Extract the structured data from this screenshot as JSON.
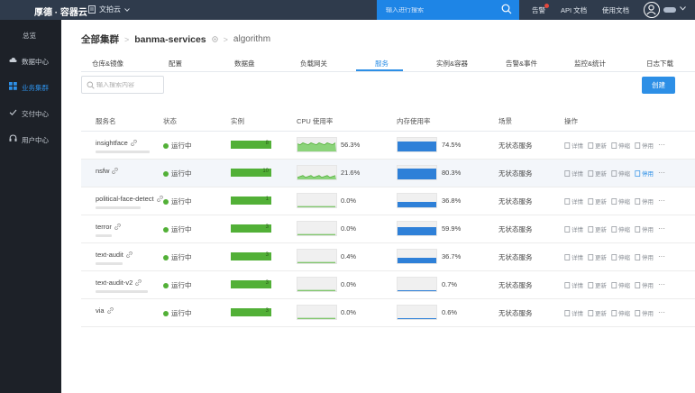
{
  "topbar": {
    "brand": "厚德 · 容器云",
    "project": "文拍云",
    "search_placeholder": "输入进行搜索",
    "nav": [
      "告警",
      "API 文档",
      "使用文档"
    ]
  },
  "sidebar": {
    "items": [
      {
        "label": "总览"
      },
      {
        "label": "数据中心"
      },
      {
        "label": "业务集群"
      },
      {
        "label": "交付中心"
      },
      {
        "label": "用户中心"
      }
    ],
    "active_index": 2
  },
  "breadcrumb": [
    "全部集群",
    "banma-services",
    "algorithm"
  ],
  "tabs": [
    "仓库&镜像",
    "配置",
    "数据盘",
    "负载网关",
    "服务",
    "实例&容器",
    "告警&事件",
    "监控&统计",
    "日志下载"
  ],
  "active_tab": 4,
  "filter_placeholder": "输入搜索内容",
  "create_label": "创建",
  "table": {
    "headers": [
      "服务名",
      "状态",
      "实例",
      "CPU 使用率",
      "内存使用率",
      "场景",
      "操作"
    ],
    "ops": [
      "详情",
      "更新",
      "伸缩",
      "停用"
    ],
    "more": "···",
    "rows": [
      {
        "name": "insightface",
        "status": "运行中",
        "instances": "8",
        "cpu": "56.3%",
        "cpu_value": 56.3,
        "mem": "74.5%",
        "mem_value": 74.5,
        "scene": "无状态服务"
      },
      {
        "name": "nsfw",
        "status": "运行中",
        "instances": "10",
        "cpu": "21.6%",
        "cpu_value": 21.6,
        "mem": "80.3%",
        "mem_value": 80.3,
        "scene": "无状态服务"
      },
      {
        "name": "political-face-detect",
        "status": "运行中",
        "instances": "1",
        "cpu": "0.0%",
        "cpu_value": 0.0,
        "mem": "36.8%",
        "mem_value": 36.8,
        "scene": "无状态服务"
      },
      {
        "name": "terror",
        "status": "运行中",
        "instances": "3",
        "cpu": "0.0%",
        "cpu_value": 0.0,
        "mem": "59.9%",
        "mem_value": 59.9,
        "scene": "无状态服务"
      },
      {
        "name": "text-audit",
        "status": "运行中",
        "instances": "3",
        "cpu": "0.4%",
        "cpu_value": 0.4,
        "mem": "36.7%",
        "mem_value": 36.7,
        "scene": "无状态服务"
      },
      {
        "name": "text-audit-v2",
        "status": "运行中",
        "instances": "3",
        "cpu": "0.0%",
        "cpu_value": 0.0,
        "mem": "0.7%",
        "mem_value": 0.7,
        "scene": "无状态服务"
      },
      {
        "name": "via",
        "status": "运行中",
        "instances": "3",
        "cpu": "0.0%",
        "cpu_value": 0.0,
        "mem": "0.6%",
        "mem_value": 0.6,
        "scene": "无状态服务"
      }
    ]
  },
  "colors": {
    "topbar": "#2f3b4c",
    "sidebar": "#1d2128",
    "accent": "#2d8fe6",
    "running": "#52b037",
    "memory": "#2e80d8"
  }
}
